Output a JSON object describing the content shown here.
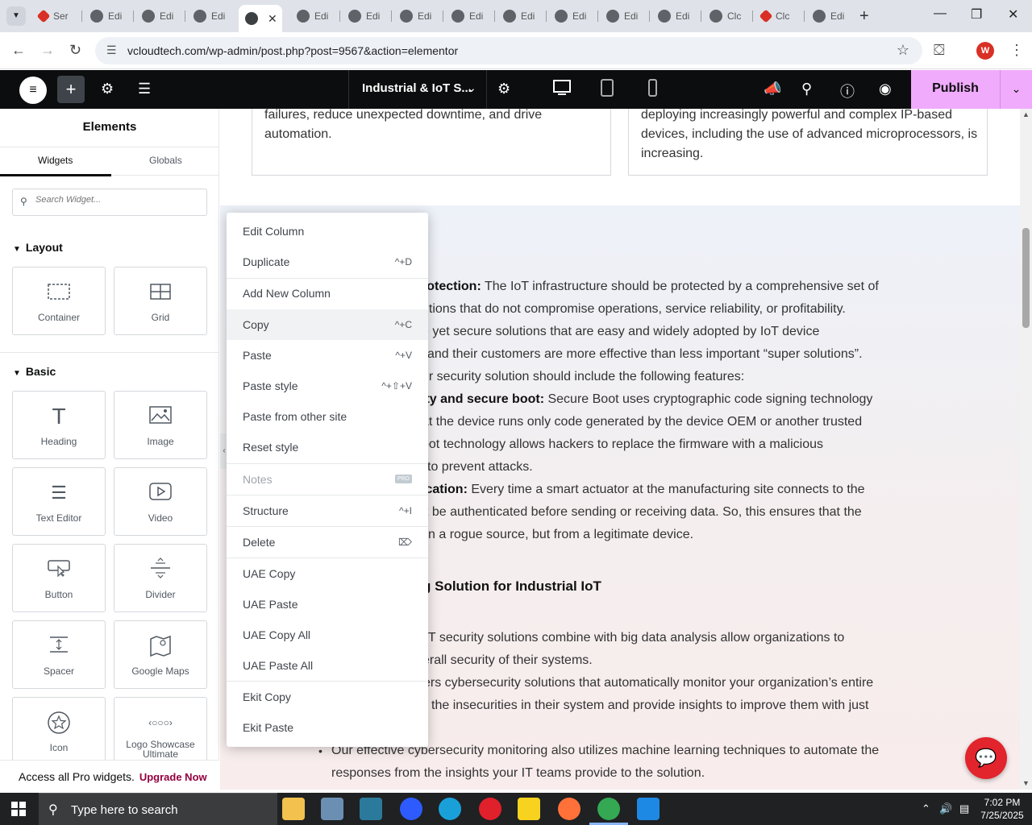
{
  "browser": {
    "tabs": [
      {
        "label": "Ser",
        "icon": "elementor-red-icon"
      },
      {
        "label": "Edi",
        "icon": "wordpress-icon"
      },
      {
        "label": "Edi",
        "icon": "wordpress-icon"
      },
      {
        "label": "Edi",
        "icon": "wordpress-icon"
      },
      {
        "label": "",
        "icon": "wordpress-icon",
        "active": true
      },
      {
        "label": "Edi",
        "icon": "wordpress-icon"
      },
      {
        "label": "Edi",
        "icon": "wordpress-icon"
      },
      {
        "label": "Edi",
        "icon": "wordpress-icon"
      },
      {
        "label": "Edi",
        "icon": "wordpress-icon"
      },
      {
        "label": "Edi",
        "icon": "wordpress-icon"
      },
      {
        "label": "Edi",
        "icon": "wordpress-icon"
      },
      {
        "label": "Edi",
        "icon": "wordpress-icon"
      },
      {
        "label": "Edi",
        "icon": "wordpress-icon"
      },
      {
        "label": "Clc",
        "icon": "elementor-red-icon"
      },
      {
        "label": "Edi",
        "icon": "wordpress-icon"
      }
    ],
    "url": "vcloudtech.com/wp-admin/post.php?post=9567&action=elementor",
    "profile_initial": "W"
  },
  "editor": {
    "doc_title": "Industrial & IoT S...",
    "publish_label": "Publish",
    "accent_color": "#f0abfc"
  },
  "panel": {
    "title": "Elements",
    "tabs": [
      "Widgets",
      "Globals"
    ],
    "search_placeholder": "Search Widget...",
    "sections": {
      "layout": "Layout",
      "basic": "Basic"
    },
    "layout_widgets": [
      {
        "label": "Container",
        "icon": "container-icon"
      },
      {
        "label": "Grid",
        "icon": "grid-icon"
      }
    ],
    "basic_widgets": [
      {
        "label": "Heading",
        "icon": "heading-icon"
      },
      {
        "label": "Image",
        "icon": "image-icon"
      },
      {
        "label": "Text Editor",
        "icon": "text-editor-icon"
      },
      {
        "label": "Video",
        "icon": "video-icon"
      },
      {
        "label": "Button",
        "icon": "button-icon"
      },
      {
        "label": "Divider",
        "icon": "divider-icon"
      },
      {
        "label": "Spacer",
        "icon": "spacer-icon"
      },
      {
        "label": "Google Maps",
        "icon": "google-maps-icon"
      },
      {
        "label": "Icon",
        "icon": "star-icon"
      },
      {
        "label": "Logo Showcase Ultimate",
        "icon": "logo-showcase-icon"
      }
    ],
    "promo_text": "Access all Pro widgets.",
    "promo_link": "Upgrade Now"
  },
  "content": {
    "card_left": "failures, reduce unexpected downtime, and drive automation.",
    "card_right": "deploying increasingly powerful and complex IP-based devices, including the use of advanced microprocessors, is increasing.",
    "lines": [
      {
        "bold": "rotection:",
        "text": " The IoT infrastructure should be protected by a comprehensive set of"
      },
      {
        "bold": "",
        "text": "utions that do not compromise operations, service reliability, or profitability."
      },
      {
        "bold": "",
        "text": "e yet secure solutions that are easy and widely adopted by IoT device"
      },
      {
        "bold": "",
        "text": "and their customers are more effective than less important “super solutions”."
      },
      {
        "bold": "",
        "text": "ur security solution should include the following features:"
      },
      {
        "bold": "ity and secure boot:",
        "text": " Secure Boot uses cryptographic code signing technology"
      },
      {
        "bold": "",
        "text": "at the device runs only code generated by the device OEM or another trusted"
      },
      {
        "bold": "",
        "text": "oot technology allows hackers to replace the firmware with a malicious"
      },
      {
        "bold": "",
        "text": "to prevent attacks."
      },
      {
        "bold": "ication:",
        "text": " Every time a smart actuator at the manufacturing site connects to the"
      },
      {
        "bold": "",
        "text": "t be authenticated before sending or receiving data. So, this ensures that the"
      },
      {
        "bold": "",
        "text": "n a rogue source, but from a legitimate device."
      }
    ],
    "heading": "g Solution for Industrial IoT",
    "lines2": [
      "oT security solutions combine with big data analysis allow organizations to",
      "erall security of their systems.",
      "ers cybersecurity solutions that automatically monitor your organization’s entire",
      "the insecurities in their system and provide insights to improve them with just"
    ],
    "bullet1a": "Our effective cybersecurity monitoring also utilizes machine learning techniques to automate the",
    "bullet1b": "responses from the insights your IT teams provide to the solution."
  },
  "context_menu": {
    "items": [
      {
        "label": "Edit Column",
        "shortcut": ""
      },
      {
        "label": "Duplicate",
        "shortcut": "^+D"
      },
      {
        "label": "Add New Column",
        "shortcut": ""
      },
      {
        "label": "Copy",
        "shortcut": "^+C"
      },
      {
        "label": "Paste",
        "shortcut": "^+V"
      },
      {
        "label": "Paste style",
        "shortcut": "^+⇧+V"
      },
      {
        "label": "Paste from other site",
        "shortcut": ""
      },
      {
        "label": "Reset style",
        "shortcut": ""
      },
      {
        "label": "Notes",
        "shortcut": "PRO"
      },
      {
        "label": "Structure",
        "shortcut": "^+I"
      },
      {
        "label": "Delete",
        "shortcut": "⌦"
      },
      {
        "label": "UAE Copy",
        "shortcut": ""
      },
      {
        "label": "UAE Paste",
        "shortcut": ""
      },
      {
        "label": "UAE Copy All",
        "shortcut": ""
      },
      {
        "label": "UAE Paste All",
        "shortcut": ""
      },
      {
        "label": "Ekit Copy",
        "shortcut": ""
      },
      {
        "label": "Ekit Paste",
        "shortcut": ""
      }
    ]
  },
  "taskbar": {
    "search_placeholder": "Type here to search",
    "time": "7:02 PM",
    "date": "7/25/2025"
  }
}
